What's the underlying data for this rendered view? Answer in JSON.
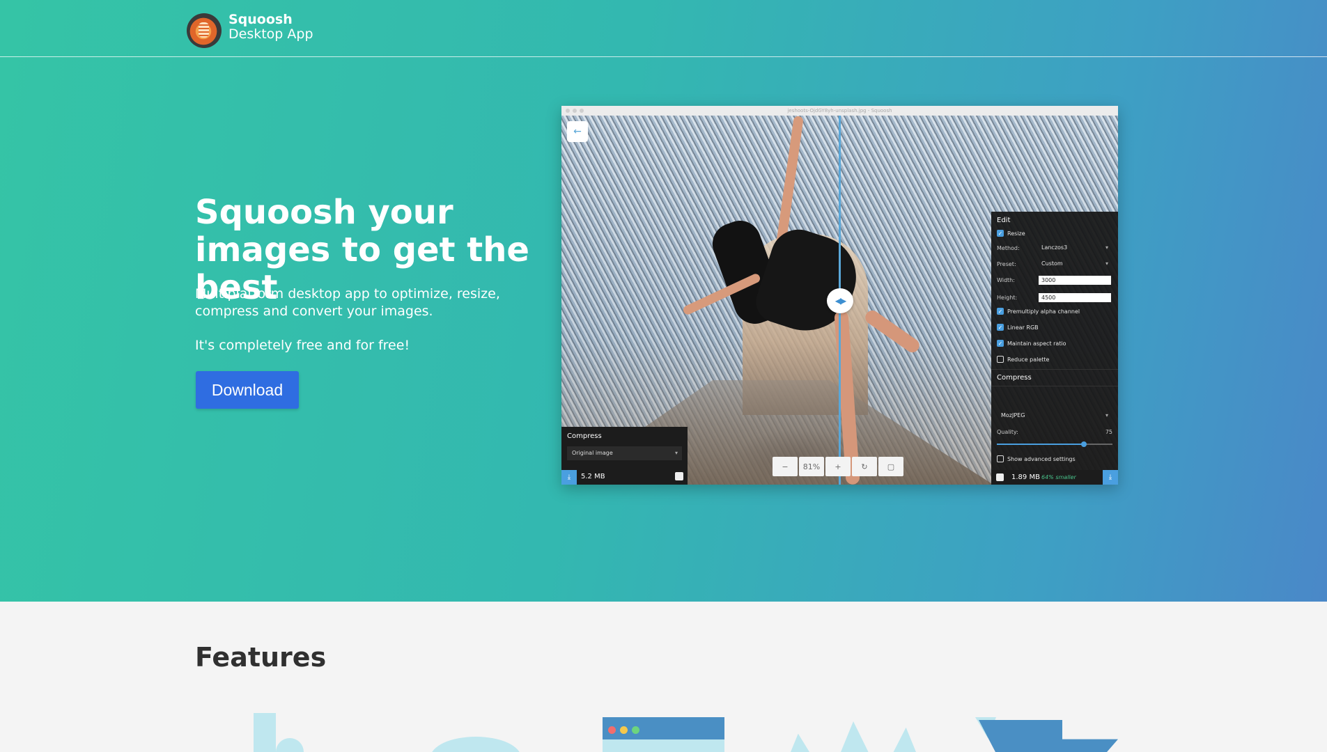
{
  "header": {
    "brand_name": "Squoosh",
    "brand_sub": "Desktop App"
  },
  "hero": {
    "headline": "Squoosh your images to get the best",
    "subtitle": "Multiplatform desktop app to optimize, resize, compress and convert your images.",
    "free_note": "It's completely free and for free!",
    "download_label": "Download"
  },
  "app": {
    "window_title": "jeshoots-OjdGY8yh-unsplash.jpg - Squoosh",
    "back_icon": "arrow-left-icon",
    "zoom": {
      "zoom_out": "−",
      "level": "81%",
      "zoom_in": "+",
      "rotate_icon": "rotate-icon",
      "background_icon": "background-toggle-icon"
    },
    "left_panel": {
      "title": "Compress",
      "codec": "Original image",
      "size": "5.2 MB"
    },
    "right_panel": {
      "edit_title": "Edit",
      "resize_label": "Resize",
      "resize_checked": true,
      "method_label": "Method:",
      "method_value": "Lanczos3",
      "preset_label": "Preset:",
      "preset_value": "Custom",
      "width_label": "Width:",
      "width_value": "3000",
      "height_label": "Height:",
      "height_value": "4500",
      "premultiply_label": "Premultiply alpha channel",
      "linear_rgb_label": "Linear RGB",
      "aspect_label": "Maintain aspect ratio",
      "reduce_palette_label": "Reduce palette",
      "compress_title": "Compress",
      "codec_value": "MozJPEG",
      "quality_label": "Quality:",
      "quality_value": "75",
      "quality_fraction": 0.75,
      "advanced_label": "Show advanced settings",
      "size": "1.89 MB",
      "smaller": "64% smaller"
    }
  },
  "features": {
    "title": "Features"
  },
  "colors": {
    "accent": "#2f6de1",
    "slider": "#4a9fe0",
    "savings": "#49c48c"
  }
}
